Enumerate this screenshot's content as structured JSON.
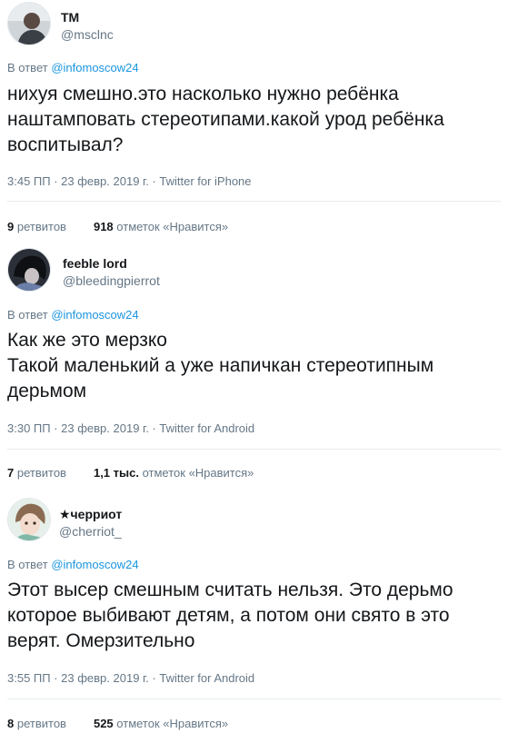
{
  "tweets": [
    {
      "name": "ТМ",
      "handle": "@msclnc",
      "reply_prefix": "В ответ",
      "reply_to": "@infomoscow24",
      "text_lines": [
        "нихуя смешно.это насколько нужно ребёнка",
        "наштамповать стереотипами.какой урод ребёнка",
        "воспитывал?"
      ],
      "meta": "3:45 ПП · 23 февр. 2019 г. · Twitter for iPhone",
      "retweets_count": "9",
      "retweets_label": "ретвитов",
      "likes_count": "918",
      "likes_label": "отметок «Нравится»",
      "avatar_icon": "person-photo-icon"
    },
    {
      "name": "feeble lord",
      "handle": "@bleedingpierrot",
      "reply_prefix": "В ответ",
      "reply_to": "@infomoscow24",
      "text_lines": [
        "Как же это мерзко",
        "Такой маленький а уже напичкан стереотипным",
        "дерьмом"
      ],
      "meta": "3:30 ПП · 23 февр. 2019 г. · Twitter for Android",
      "retweets_count": "7",
      "retweets_label": "ретвитов",
      "likes_count": "1,1 тыс.",
      "likes_label": "отметок «Нравится»",
      "avatar_icon": "dark-portrait-icon"
    },
    {
      "name": "★черриот",
      "handle": "@cherriot_",
      "reply_prefix": "В ответ",
      "reply_to": "@infomoscow24",
      "text_lines": [
        "Этот высер смешным считать нельзя. Это дерьмо",
        "которое выбивают детям, а потом они свято в это",
        "верят. Омерзительно"
      ],
      "meta": "3:55 ПП · 23 февр. 2019 г. · Twitter for Android",
      "retweets_count": "8",
      "retweets_label": "ретвитов",
      "likes_count": "525",
      "likes_label": "отметок «Нравится»",
      "avatar_icon": "anime-character-icon"
    }
  ],
  "colors": {
    "text": "#14171a",
    "secondary": "#657786",
    "link": "#1b95e0",
    "divider": "#e6ecf0"
  }
}
